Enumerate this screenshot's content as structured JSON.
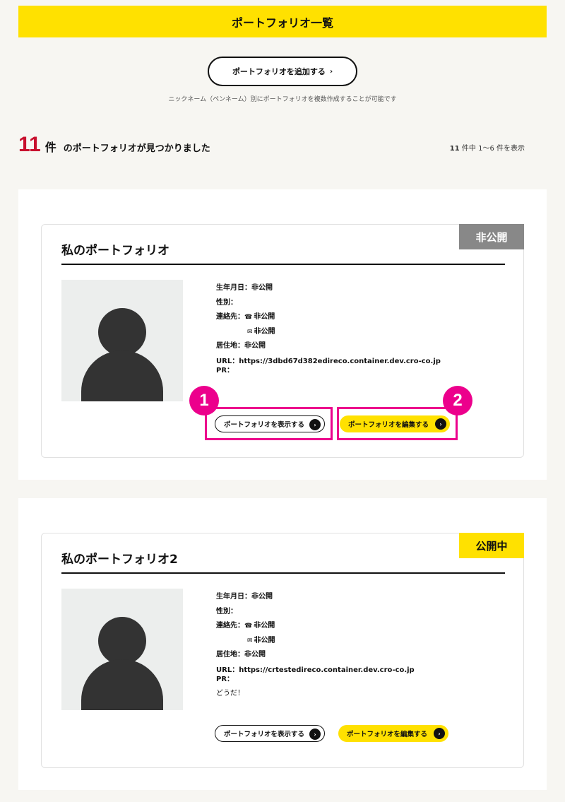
{
  "header": {
    "title": "ポートフォリオ一覧"
  },
  "add_button": {
    "label": "ポートフォリオを追加する",
    "chevron": "›"
  },
  "note": "ニックネーム（ペンネーム）別にポートフォリオを複数作成することが可能です",
  "results": {
    "count": "11",
    "unit": "件",
    "text": "のポートフォリオが見つかりました",
    "range_count": "11",
    "range_text": "件中  1〜6 件を表示"
  },
  "labels": {
    "birthday": "生年月日：",
    "gender": "性別：",
    "contact": "連絡先：",
    "residence": "居住地：",
    "url": "URL：",
    "pr": "PR："
  },
  "icons": {
    "phone": "phone-icon",
    "mail": "mail-icon",
    "arrow": "arrow-right-icon"
  },
  "portfolios": [
    {
      "title": "私のポートフォリオ",
      "status": "非公開",
      "birthday": "非公開",
      "gender": "",
      "phone": "非公開",
      "mail": "非公開",
      "residence": "非公開",
      "url": "https://3dbd67d382edireco.container.dev.cro-co.jp",
      "pr": "",
      "view_label": "ポートフォリオを表示する",
      "edit_label": "ポートフォリオを編集する"
    },
    {
      "title": "私のポートフォリオ2",
      "status": "公開中",
      "birthday": "非公開",
      "gender": "",
      "phone": "非公開",
      "mail": "非公開",
      "residence": "非公開",
      "url": "https://crtestedireco.container.dev.cro-co.jp",
      "pr": "どうだ！",
      "view_label": "ポートフォリオを表示する",
      "edit_label": "ポートフォリオを編集する"
    }
  ],
  "annotations": {
    "marker_1": "1",
    "marker_2": "2"
  },
  "colors": {
    "accent": "#ffe100",
    "count": "#c8102e",
    "highlight": "#ec008c",
    "private_badge": "#888888"
  }
}
